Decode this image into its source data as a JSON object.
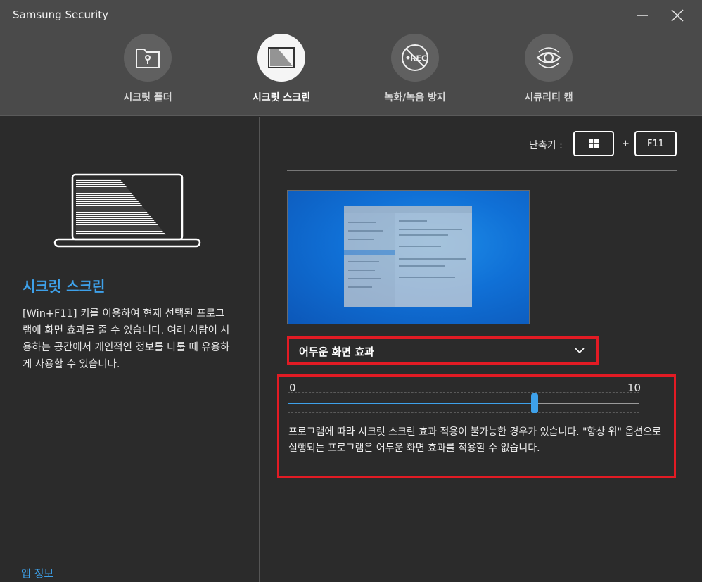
{
  "window": {
    "title": "Samsung Security",
    "minimize_icon": "minimize-icon",
    "close_icon": "close-icon"
  },
  "tabs": [
    {
      "label": "시크릿 폴더",
      "icon": "secret-folder-icon",
      "active": false
    },
    {
      "label": "시크릿 스크린",
      "icon": "secret-screen-icon",
      "active": true
    },
    {
      "label": "녹화/녹음 방지",
      "icon": "no-rec-icon",
      "active": false
    },
    {
      "label": "시큐리티 캠",
      "icon": "security-cam-icon",
      "active": false
    }
  ],
  "left": {
    "title": "시크릿 스크린",
    "description": "[Win+F11] 키를 이용하여 현재 선택된 프로그램에 화면 효과를 줄 수 있습니다. 여러 사람이 사용하는 공간에서 개인적인 정보를 다룰 때 유용하게 사용할 수 있습니다.",
    "app_info_link": "앱 정보"
  },
  "right": {
    "shortcut_label": "단축키 :",
    "key_windows_icon": "windows-logo-icon",
    "plus": "+",
    "key_f11": "F11",
    "effect_select_value": "어두운 화면 효과",
    "slider": {
      "min_label": "0",
      "max_label": "10",
      "value": 7
    },
    "note": "프로그램에 따라 시크릿 스크린 효과 적용이 불가능한 경우가 있습니다. \"항상 위\" 옵션으로 실행되는 프로그램은 어두운 화면 효과를 적용할 수 없습니다."
  },
  "colors": {
    "accent_blue": "#3ea1ea",
    "highlight_red": "#e21b24",
    "header_bg": "#4a4a4a",
    "body_bg": "#2b2b2b"
  }
}
